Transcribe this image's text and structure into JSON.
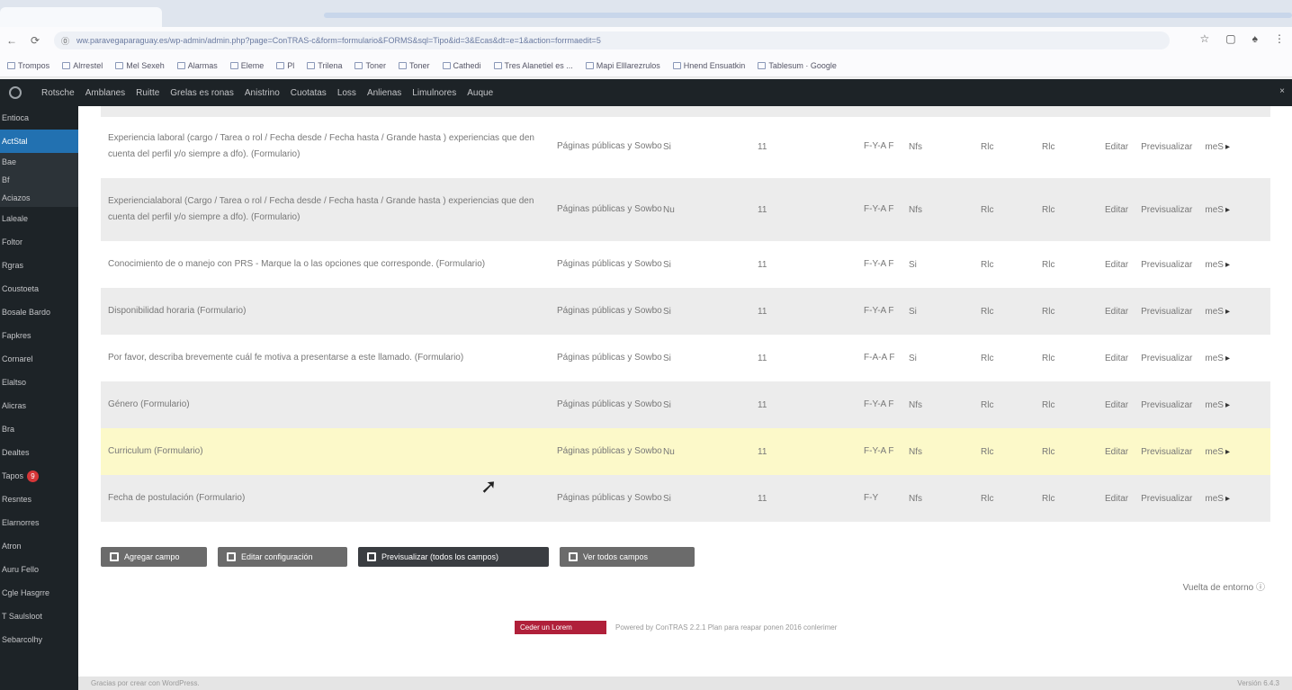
{
  "browser": {
    "url": "ww.paravegaparaguay.es/wp-admin/admin.php?page=ConTRAS-c&form=formulario&FORMS&sql=Tipo&id=3&Ecas&dt=e=1&action=forrmaedit=5",
    "nav": {
      "back": "←",
      "reload": "⟳",
      "info": "⓪"
    },
    "right_icons": [
      "☆",
      "▢",
      "♠",
      "⋮"
    ],
    "bookmarks": [
      "Trompos",
      "Alrrestel",
      "Mel Sexeh",
      "Alarmas",
      "Eleme",
      "Pl",
      "Trilena",
      "Toner",
      "Toner",
      "Cathedi",
      "Tres Alanetiel es ...",
      "Mapi Elllarezrulos",
      "Hnend Ensuatkin",
      "Tablesum · Google"
    ]
  },
  "adminbar": {
    "items": [
      "Rotsche",
      "Amblanes",
      "Ruitte",
      "Grelas es ronas",
      "Anistrino",
      "Cuotatas",
      "Loss",
      "Anlienas",
      "Limulnores",
      "Auque"
    ],
    "close": "×"
  },
  "sidebar": {
    "items": [
      {
        "label": "Entioca",
        "type": "normal"
      },
      {
        "label": "ActStal",
        "type": "current"
      },
      {
        "label": "Bae",
        "type": "sub"
      },
      {
        "label": "Bf",
        "type": "sub"
      },
      {
        "label": "Aciazos",
        "type": "sub"
      },
      {
        "label": "Laleale",
        "type": "normal"
      },
      {
        "label": "Foltor",
        "type": "normal"
      },
      {
        "label": "Rgras",
        "type": "normal"
      },
      {
        "label": "Coustoeta",
        "type": "normal"
      },
      {
        "label": "Bosale Bardo",
        "type": "normal"
      },
      {
        "label": "Fapkres",
        "type": "normal"
      },
      {
        "label": "Cornarel",
        "type": "normal"
      },
      {
        "label": "Elaltso",
        "type": "normal"
      },
      {
        "label": "Alicras",
        "type": "normal"
      },
      {
        "label": "Bra",
        "type": "normal"
      },
      {
        "label": "Dealtes",
        "type": "normal"
      },
      {
        "label": "Tapos",
        "type": "badge",
        "badge": "9"
      },
      {
        "label": "Resntes",
        "type": "normal"
      },
      {
        "label": "Elarnorres",
        "type": "normal"
      },
      {
        "label": "Atron",
        "type": "normal"
      },
      {
        "label": "Auru Fello",
        "type": "normal"
      },
      {
        "label": "Cgle Hasgrre",
        "type": "normal"
      },
      {
        "label": "T Saulsloot",
        "type": "normal"
      },
      {
        "label": "Sebarcolhy",
        "type": "normal"
      }
    ]
  },
  "table": {
    "actions": [
      "Editar",
      "Previsualizar",
      "meS"
    ],
    "rows": [
      {
        "name": "Experiencia laboral (cargo / Tarea o rol / Fecha desde / Fecha hasta / Grande hasta ) experiencias que den cuenta del perfil y/o siempre a dfo). (Formulario)",
        "section": "Páginas públicas y Sowbo",
        "required": "Si",
        "order": "11",
        "visible": "F-Y-A F",
        "a": "Nfs",
        "b": "Rlc",
        "c": "Rlc",
        "style": "normal"
      },
      {
        "name": "Experiencialaboral (Cargo / Tarea o rol / Fecha desde / Fecha hasta / Grande hasta ) experiencias que den cuenta del perfil y/o siempre a dfo). (Formulario)",
        "section": "Páginas públicas y Sowbo",
        "required": "Nu",
        "order": "11",
        "visible": "F-Y-A F",
        "a": "Nfs",
        "b": "Rlc",
        "c": "Rlc",
        "style": "alt"
      },
      {
        "name": "Conocimiento de o manejo con PRS - Marque la o las opciones que corresponde. (Formulario)",
        "section": "Páginas públicas y Sowbo",
        "required": "Si",
        "order": "11",
        "visible": "F-Y-A F",
        "a": "Si",
        "b": "Rlc",
        "c": "Rlc",
        "style": "normal"
      },
      {
        "name": "Disponibilidad horaria (Formulario)",
        "section": "Páginas públicas y Sowbo",
        "required": "Si",
        "order": "11",
        "visible": "F-Y-A F",
        "a": "Si",
        "b": "Rlc",
        "c": "Rlc",
        "style": "alt"
      },
      {
        "name": "Por favor, describa brevemente cuál fe motiva a presentarse a este llamado. (Formulario)",
        "section": "Páginas públicas y Sowbo",
        "required": "Si",
        "order": "11",
        "visible": "F-A-A F",
        "a": "Si",
        "b": "Rlc",
        "c": "Rlc",
        "style": "normal"
      },
      {
        "name": "Género (Formulario)",
        "section": "Páginas públicas y Sowbo",
        "required": "Si",
        "order": "11",
        "visible": "F-Y-A F",
        "a": "Nfs",
        "b": "Rlc",
        "c": "Rlc",
        "style": "alt"
      },
      {
        "name": "Curriculum (Formulario)",
        "section": "Páginas públicas y Sowbo",
        "required": "Nu",
        "order": "11",
        "visible": "F-Y-A F",
        "a": "Nfs",
        "b": "Rlc",
        "c": "Rlc",
        "style": "hl"
      },
      {
        "name": "Fecha de postulación (Formulario)",
        "section": "Páginas públicas y Sowbo",
        "required": "Si",
        "order": "11",
        "visible": "F-Y",
        "a": "Nfs",
        "b": "Rlc",
        "c": "Rlc",
        "style": "alt"
      }
    ]
  },
  "buttons": {
    "add": "Agregar campo",
    "edit": "Editar configuración",
    "preview": "Previsualizar (todos los campos)",
    "delete": "Ver todos campos"
  },
  "back_link": "Vuelta de entorno",
  "footer": {
    "badge": "Ceder un Lorem",
    "powered": "Powered by ConTRAS 2.2.1 Plan para reapar ponen 2016 conlerimer"
  },
  "bottombar": {
    "left": "Gracias por crear con WordPress.",
    "right": "Versión 6.4.3"
  }
}
